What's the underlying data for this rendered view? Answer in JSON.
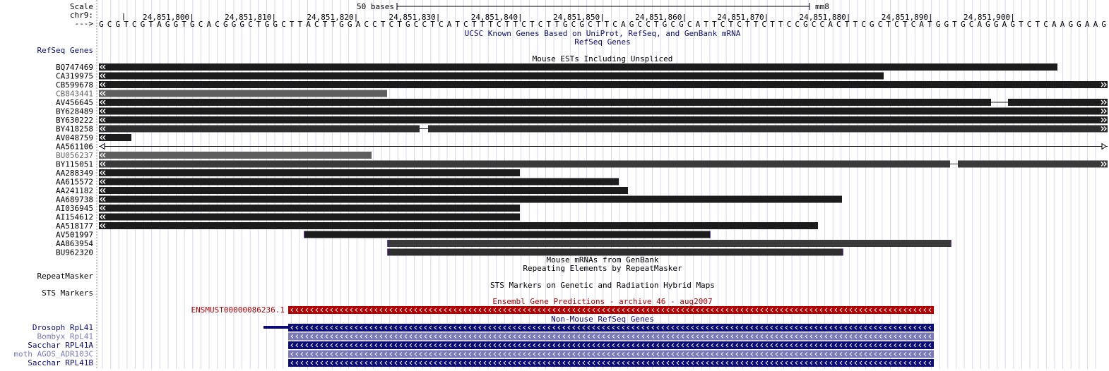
{
  "header": {
    "scale_label": "Scale",
    "chrom_label": "chr9:",
    "strand_label": "--->",
    "scale_bar_text": "50 bases",
    "assembly": "mm8",
    "ticks": [
      {
        "pos": 24851800,
        "label": "24,851,800|"
      },
      {
        "pos": 24851810,
        "label": "24,851,810|"
      },
      {
        "pos": 24851820,
        "label": "24,851,820|"
      },
      {
        "pos": 24851830,
        "label": "24,851,830|"
      },
      {
        "pos": 24851840,
        "label": "24,851,840|"
      },
      {
        "pos": 24851850,
        "label": "24,851,850|"
      },
      {
        "pos": 24851860,
        "label": "24,851,860|"
      },
      {
        "pos": 24851870,
        "label": "24,851,870|"
      },
      {
        "pos": 24851880,
        "label": "24,851,880|"
      },
      {
        "pos": 24851890,
        "label": "24,851,890|"
      },
      {
        "pos": 24851900,
        "label": "24,851,900|"
      }
    ],
    "sequence": "GCGTCGTAGGTGCACGGGCTGGCTTACTTGGACCTCTGCCTCATCTTTCTTCTCTTGCGCTTCAGCCTGCGCATTCTCTTCTTCCGCCACTTCGCTCTCATGGTGCAGGAGTCTCAAGGAAG"
  },
  "tracks": {
    "known_genes_title": "UCSC Known Genes Based on UniProt, RefSeq, and GenBank mRNA",
    "refseq_title": "RefSeq Genes",
    "refseq_side_label": "RefSeq Genes",
    "ests_title": "Mouse ESTs Including Unspliced",
    "mrna_title": "Mouse mRNAs from GenBank",
    "repeat_title": "Repeating Elements by RepeatMasker",
    "repeat_side_label": "RepeatMasker",
    "sts_title": "STS Markers on Genetic and Radiation Hybrid Maps",
    "sts_side_label": "STS Markers",
    "ensembl_title": "Ensembl Gene Predictions - archive 46 - aug2007",
    "ensembl_gene": "ENSMUST00000086236.1",
    "nonmouse_title": "Non-Mouse RefSeq Genes"
  },
  "ests": [
    {
      "name": "BQ747469",
      "start": 0,
      "end": 1497,
      "color": "#1c1c1c",
      "label_color": "#000000",
      "left_arrow": true,
      "right_arrow": false
    },
    {
      "name": "CA319975",
      "start": 0,
      "end": 1251,
      "color": "#1c1c1c",
      "label_color": "#000000",
      "left_arrow": true,
      "right_arrow": false
    },
    {
      "name": "CB599678",
      "start": 0,
      "end": 1570,
      "color": "#1c1c1c",
      "label_color": "#000000",
      "left_arrow": true,
      "right_arrow": true
    },
    {
      "name": "CB843441",
      "start": 0,
      "end": 548,
      "color": "#5e5e5e",
      "label_color": "#666666",
      "left_arrow": true,
      "right_arrow": false
    },
    {
      "name": "AV456645",
      "start": 0,
      "end": 1570,
      "color": "#1c1c1c",
      "label_color": "#000000",
      "left_arrow": true,
      "right_arrow": true,
      "gap": [
        1403,
        1427
      ]
    },
    {
      "name": "BY628489",
      "start": 0,
      "end": 1570,
      "color": "#1c1c1c",
      "label_color": "#000000",
      "left_arrow": true,
      "right_arrow": true
    },
    {
      "name": "BY630222",
      "start": 0,
      "end": 1570,
      "color": "#1c1c1c",
      "label_color": "#000000",
      "left_arrow": true,
      "right_arrow": true
    },
    {
      "name": "BY418258",
      "start": 0,
      "end": 1570,
      "color": "#2e2e2e",
      "label_color": "#000000",
      "left_arrow": true,
      "right_arrow": true,
      "gap": [
        594,
        606
      ]
    },
    {
      "name": "AV048759",
      "start": 0,
      "end": 186,
      "color": "#1c1c1c",
      "label_color": "#000000",
      "left_arrow": true,
      "right_arrow": false
    },
    {
      "name": "AA561106",
      "start": 0,
      "end": 1570,
      "color": "#ffffff",
      "label_color": "#000000",
      "left_arrow": true,
      "right_arrow": true,
      "outline": true
    },
    {
      "name": "BU056237",
      "start": 0,
      "end": 526,
      "color": "#5e5e5e",
      "label_color": "#666666",
      "left_arrow": true,
      "right_arrow": false
    },
    {
      "name": "BY115051",
      "start": 0,
      "end": 1570,
      "color": "#3a3a3a",
      "label_color": "#000000",
      "left_arrow": true,
      "right_arrow": true,
      "gap": [
        1345,
        1356
      ]
    },
    {
      "name": "AA288349",
      "start": 0,
      "end": 736,
      "color": "#1c1c1c",
      "label_color": "#000000",
      "left_arrow": true,
      "right_arrow": false
    },
    {
      "name": "AA615572",
      "start": 0,
      "end": 876,
      "color": "#1c1c1c",
      "label_color": "#000000",
      "left_arrow": true,
      "right_arrow": false
    },
    {
      "name": "AA241182",
      "start": 0,
      "end": 889,
      "color": "#1c1c1c",
      "label_color": "#000000",
      "left_arrow": true,
      "right_arrow": false
    },
    {
      "name": "AA689738",
      "start": 0,
      "end": 1192,
      "color": "#1c1c1c",
      "label_color": "#000000",
      "left_arrow": true,
      "right_arrow": false
    },
    {
      "name": "AI036945",
      "start": 0,
      "end": 736,
      "color": "#1c1c1c",
      "label_color": "#000000",
      "left_arrow": true,
      "right_arrow": false
    },
    {
      "name": "AI154612",
      "start": 0,
      "end": 736,
      "color": "#1c1c1c",
      "label_color": "#000000",
      "left_arrow": true,
      "right_arrow": false
    },
    {
      "name": "AA518177",
      "start": 0,
      "end": 1158,
      "color": "#1c1c1c",
      "label_color": "#000000",
      "left_arrow": true,
      "right_arrow": false
    },
    {
      "name": "AV501997",
      "start": 290,
      "end": 1006,
      "color": "#1c1c1c",
      "label_color": "#000000",
      "left_arrow": false,
      "right_arrow": false
    },
    {
      "name": "AA863954",
      "start": 408,
      "end": 1347,
      "color": "#3a3a3a",
      "label_color": "#000000",
      "left_arrow": false,
      "right_arrow": false
    },
    {
      "name": "BU962320",
      "start": 408,
      "end": 1194,
      "color": "#2e2e2e",
      "label_color": "#000000",
      "left_arrow": false,
      "right_arrow": false
    }
  ],
  "nonmouse_genes": [
    {
      "name": "Drosoph RpL41",
      "color": "#0c0c78",
      "label_color": "#0c0c78",
      "intron": [
        373,
        408
      ]
    },
    {
      "name": "Bombyx RpL41",
      "color": "#7a7ab8",
      "label_color": "#7a7ab8"
    },
    {
      "name": "Sacchar RPL41A",
      "color": "#0c0c78",
      "label_color": "#0c0c78"
    },
    {
      "name": "moth AGOS_ADR103C",
      "color": "#7a7ab8",
      "label_color": "#7a7ab8"
    },
    {
      "name": "Sacchar RPL41B",
      "color": "#0c0c78",
      "label_color": "#0c0c78"
    }
  ],
  "colors": {
    "grid": "#d8d8f0",
    "ensembl": "#b40000",
    "track_title": "#000000",
    "known_genes_title": "#0c0c78",
    "nonmouse_title": "#0c0c78",
    "side_label_blue": "#0c0c78"
  }
}
